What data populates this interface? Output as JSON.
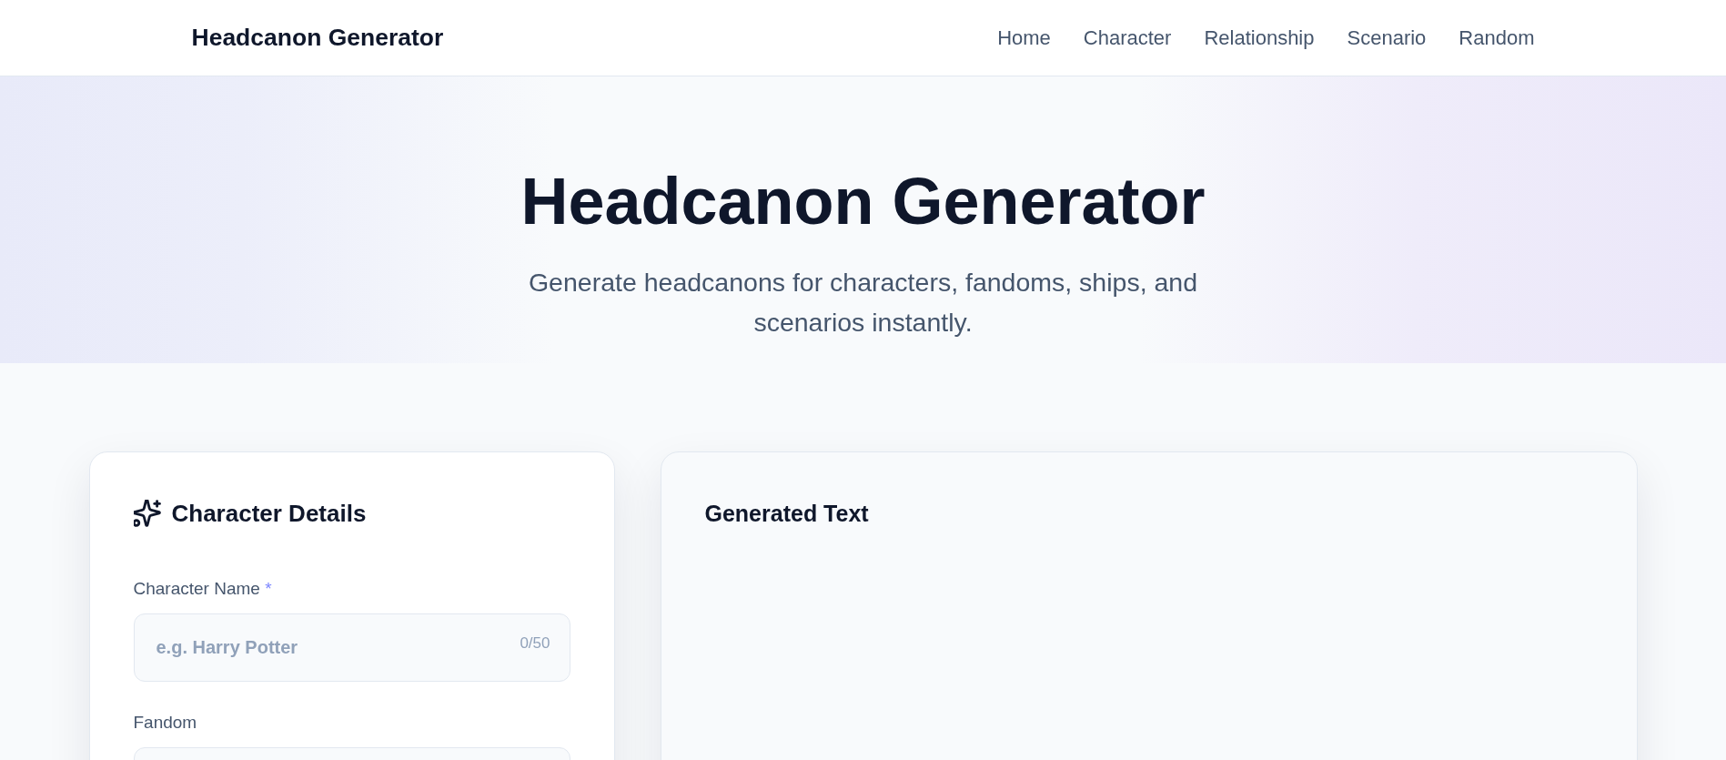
{
  "header": {
    "logo": "Headcanon Generator",
    "nav": [
      "Home",
      "Character",
      "Relationship",
      "Scenario",
      "Random"
    ]
  },
  "hero": {
    "title": "Headcanon Generator",
    "subtitle": "Generate headcanons for characters, fandoms, ships, and scenarios instantly."
  },
  "form_card": {
    "title": "Character Details",
    "fields": [
      {
        "label": "Character Name",
        "required_mark": "*",
        "placeholder": "e.g. Harry Potter",
        "counter": "0/50"
      },
      {
        "label": "Fandom"
      }
    ]
  },
  "output_card": {
    "title": "Generated Text"
  }
}
